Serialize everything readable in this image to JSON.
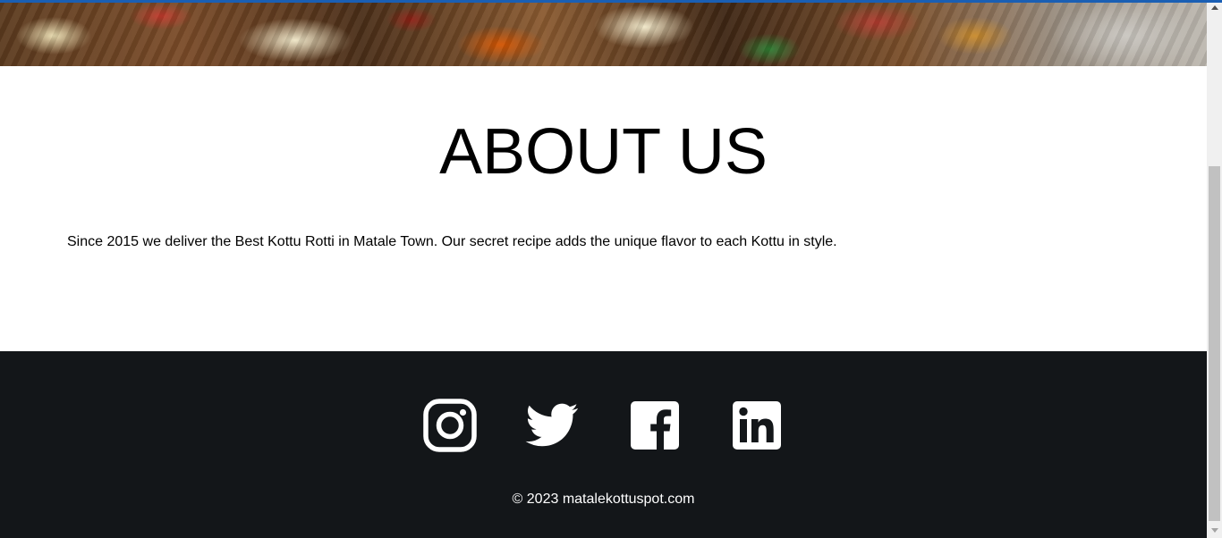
{
  "hero": {
    "image": "kottu-food-photo"
  },
  "about": {
    "title": "ABOUT US",
    "body": "Since 2015 we deliver the Best Kottu Rotti in Matale Town. Our secret recipe adds the unique flavor to each Kottu in style."
  },
  "footer": {
    "social": [
      {
        "name": "instagram",
        "icon": "instagram-icon"
      },
      {
        "name": "twitter",
        "icon": "twitter-icon"
      },
      {
        "name": "facebook",
        "icon": "facebook-icon"
      },
      {
        "name": "linkedin",
        "icon": "linkedin-icon"
      }
    ],
    "copyright": "© 2023 matalekottuspot.com"
  },
  "colors": {
    "footer_bg": "#131619",
    "accent": "#1a5fb4",
    "text": "#000000",
    "footer_text": "#ffffff"
  }
}
